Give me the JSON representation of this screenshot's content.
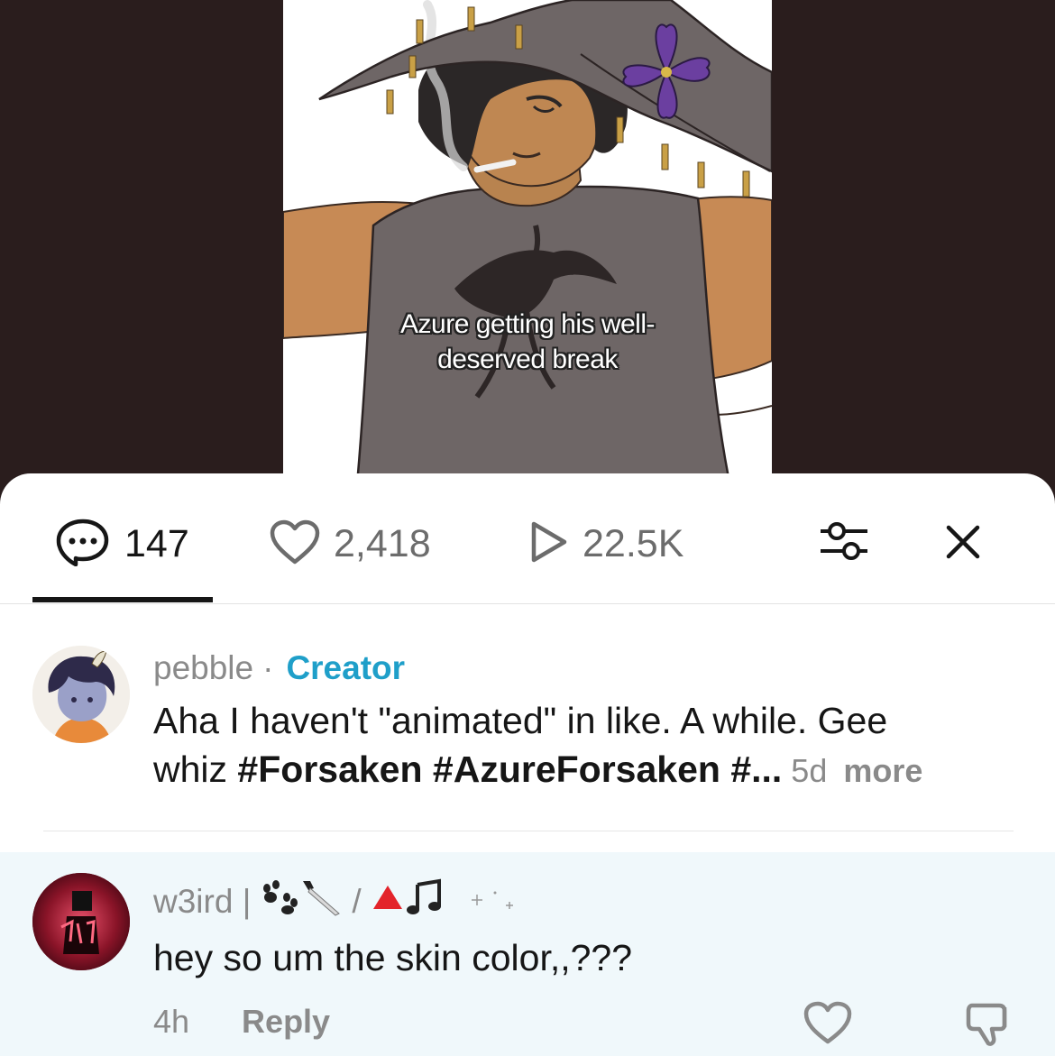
{
  "video": {
    "caption_line1": "Azure getting his well-",
    "caption_line2": "deserved break"
  },
  "stats": {
    "comments": "147",
    "likes": "2,418",
    "views": "22.5K"
  },
  "comments": [
    {
      "username": "pebble",
      "separator": "·",
      "badge": "Creator",
      "text_line1": "Aha I haven't \"animated\" in like. A while. Gee",
      "text_line2_plain": "whiz ",
      "text_line2_tags": "#Forsaken #AzureForsaken #...",
      "age": "5d",
      "more": "more"
    },
    {
      "username": "w3ird |",
      "badge_separator": "/",
      "text": "hey so um the skin color,,???",
      "age": "4h",
      "reply": "Reply"
    }
  ],
  "colors": {
    "accent": "#1f9fc9",
    "text": "#161616",
    "muted": "#8a8a8a",
    "highlight_bg": "#f0f8fb",
    "video_bg": "#2a1d1d"
  },
  "icons": [
    "comment-bubble-icon",
    "heart-icon",
    "play-icon",
    "filter-sliders-icon",
    "close-icon",
    "paw-icon",
    "knife-icon",
    "triangle-icon",
    "music-note-icon",
    "sparkle-icon",
    "thumbs-down-icon"
  ]
}
